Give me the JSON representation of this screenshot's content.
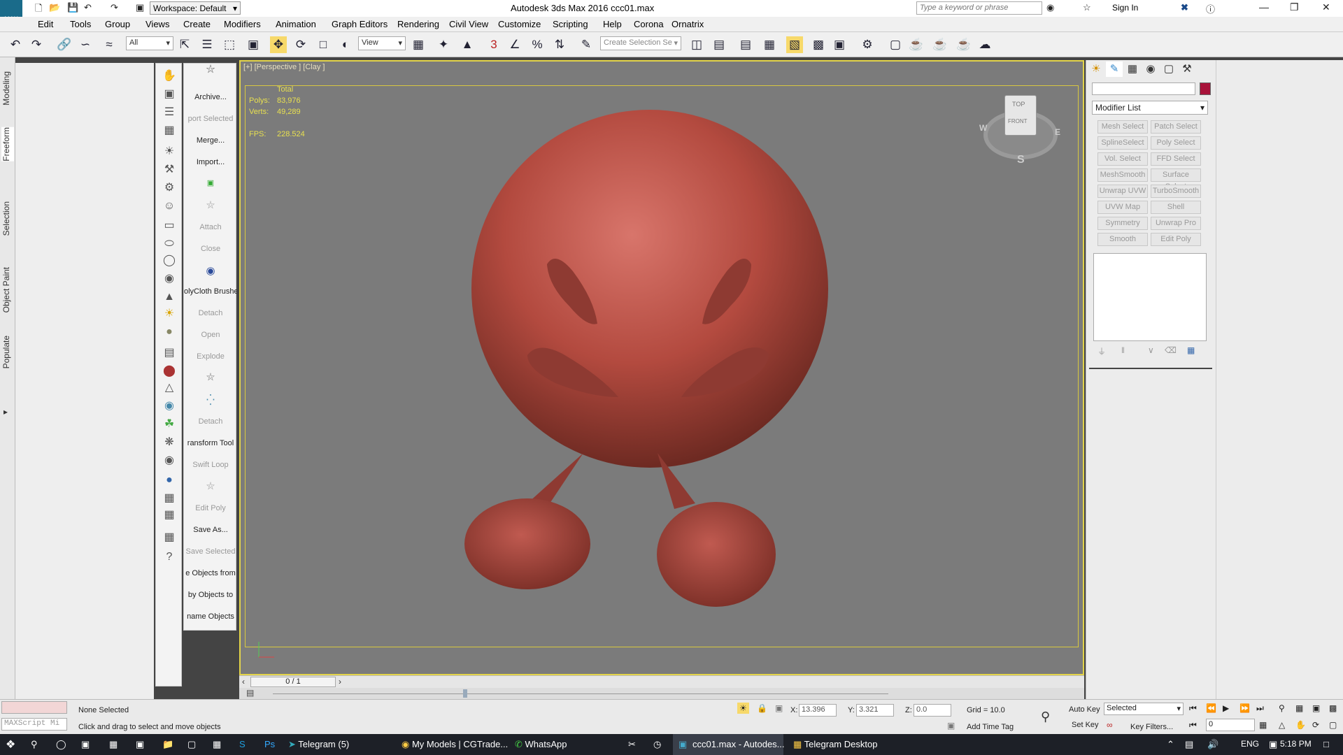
{
  "title_bar": {
    "title": "Autodesk 3ds Max 2016    ccc01.max",
    "workspace": "Workspace: Default",
    "search_placeholder": "Type a keyword or phrase",
    "sign_in": "Sign In"
  },
  "menu": [
    "Edit",
    "Tools",
    "Group",
    "Views",
    "Create",
    "Modifiers",
    "Animation",
    "Graph Editors",
    "Rendering",
    "Civil View",
    "Customize",
    "Scripting",
    "Help",
    "Corona",
    "Ornatrix"
  ],
  "toolbar": {
    "selection_filter": "All",
    "ref_coord": "View",
    "named_selection": "Create Selection Se"
  },
  "ribbon_tabs": [
    "Modeling",
    "Freeform",
    "Selection",
    "Object Paint",
    "Populate"
  ],
  "command_panel": {
    "archive": "Archive...",
    "export_selected": "port Selected",
    "merge": "Merge...",
    "import": "Import...",
    "attach": "Attach",
    "close": "Close",
    "polycloth": "olyCloth Brushe",
    "detach1": "Detach",
    "open": "Open",
    "explode": "Explode",
    "detach2": "Detach",
    "transform_tool": "ransform Tool",
    "swift_loop": "Swift Loop",
    "edit_poly": "Edit Poly",
    "save_as": "Save As...",
    "save_selected": "Save Selected",
    "objects_from": "e Objects from",
    "objects_to": "by Objects to",
    "name_objects": "name Objects"
  },
  "viewport": {
    "label": "[+] [Perspective ] [Clay ]",
    "stats_header": "Total",
    "polys_label": "Polys:",
    "polys_value": "83,976",
    "verts_label": "Verts:",
    "verts_value": "49,289",
    "fps_label": "FPS:",
    "fps_value": "228.524",
    "viewcube_top": "TOP",
    "viewcube_front": "FRONT",
    "compass_w": "W",
    "compass_e": "E",
    "compass_s": "S"
  },
  "modify_panel": {
    "modifier_list": "Modifier List",
    "buttons": [
      "Mesh Select",
      "Patch Select",
      "SplineSelect",
      "Poly Select",
      "Vol. Select",
      "FFD Select",
      "MeshSmooth",
      "Surface Select",
      "Unwrap UVW",
      "TurboSmooth",
      "UVW Map",
      "Shell",
      "Symmetry",
      "Unwrap Pro",
      "Smooth",
      "Edit Poly"
    ],
    "color": "#a8123a"
  },
  "timeline": {
    "frame": "0 / 1"
  },
  "status": {
    "maxscript": "MAXScript Mi",
    "selection": "None Selected",
    "prompt": "Click and drag to select and move objects",
    "x_label": "X:",
    "x_value": "13.396",
    "y_label": "Y:",
    "y_value": "3.321",
    "z_label": "Z:",
    "z_value": "0.0",
    "grid": "Grid = 10.0",
    "add_time_tag": "Add Time Tag",
    "auto_key": "Auto Key",
    "set_key": "Set Key",
    "selected": "Selected",
    "key_filters": "Key Filters...",
    "frame_value": "0"
  },
  "taskbar": {
    "items": [
      "Telegram (5)",
      "My Models | CGTrade...",
      "WhatsApp",
      "ccc01.max - Autodes...",
      "Telegram Desktop"
    ],
    "lang": "ENG",
    "time": "5:18 PM"
  }
}
